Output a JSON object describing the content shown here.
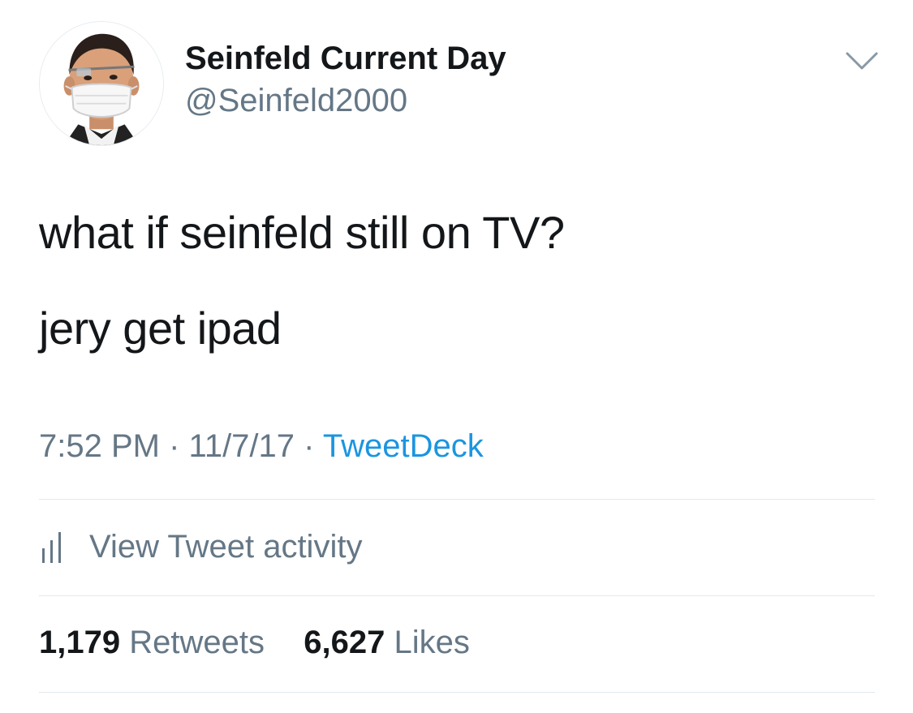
{
  "author": {
    "display_name": "Seinfeld Current Day",
    "handle": "@Seinfeld2000",
    "avatar_icon": "profile-avatar"
  },
  "menu_icon": "chevron-down-icon",
  "tweet": {
    "line1": "what if seinfeld still on TV?",
    "line2": "jery get ipad"
  },
  "meta": {
    "time": "7:52 PM",
    "separator": "·",
    "date": "11/7/17",
    "source": "TweetDeck"
  },
  "activity": {
    "icon": "analytics-bars-icon",
    "label": "View Tweet activity"
  },
  "stats": {
    "retweets_count": "1,179",
    "retweets_label": "Retweets",
    "likes_count": "6,627",
    "likes_label": "Likes"
  },
  "colors": {
    "text_primary": "#14171a",
    "text_secondary": "#657786",
    "link": "#1b95e0",
    "divider": "#e1e8ed"
  }
}
